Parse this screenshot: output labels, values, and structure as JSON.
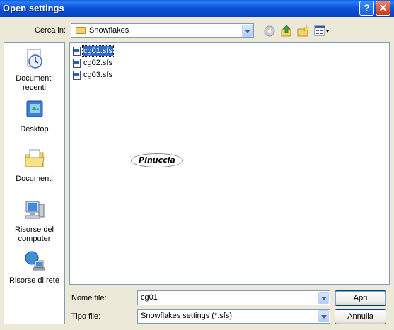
{
  "window": {
    "title": "Open settings"
  },
  "lookin": {
    "label": "Cerca in:",
    "value": "Snowflakes"
  },
  "toolbar": {
    "back_icon": "back-arrow-icon",
    "up_icon": "up-folder-icon",
    "newfolder_icon": "new-folder-icon",
    "views_icon": "views-menu-icon"
  },
  "places": [
    {
      "label": "Documenti recenti",
      "icon": "recent-documents-icon"
    },
    {
      "label": "Desktop",
      "icon": "desktop-icon"
    },
    {
      "label": "Documenti",
      "icon": "documents-folder-icon"
    },
    {
      "label": "Risorse del computer",
      "icon": "computer-icon"
    },
    {
      "label": "Risorse di rete",
      "icon": "network-icon"
    }
  ],
  "files": [
    {
      "name": "cg01.sfs",
      "selected": true
    },
    {
      "name": "cg02.sfs",
      "selected": false
    },
    {
      "name": "cg03.sfs",
      "selected": false
    }
  ],
  "watermark": "Pinuccia",
  "filename": {
    "label": "Nome file:",
    "value": "cg01"
  },
  "filetype": {
    "label": "Tipo file:",
    "value": "Snowflakes settings (*.sfs)"
  },
  "buttons": {
    "open": "Apri",
    "cancel": "Annulla"
  },
  "colors": {
    "title_bar": "#0a5fe6",
    "selection": "#316ac5",
    "dialog_bg": "#ece9d8"
  }
}
